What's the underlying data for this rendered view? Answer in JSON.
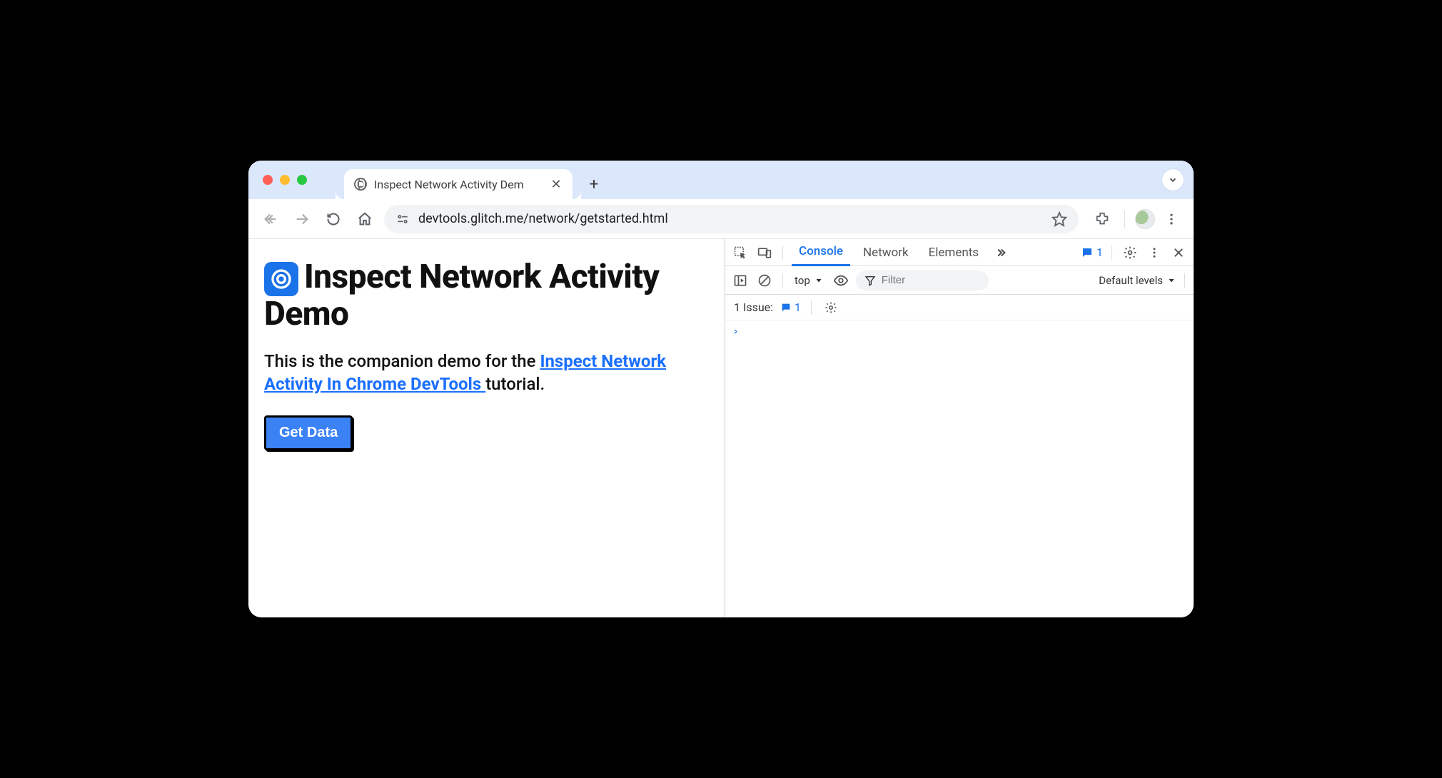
{
  "browser": {
    "tab_title": "Inspect Network Activity Dem",
    "url": "devtools.glitch.me/network/getstarted.html"
  },
  "page": {
    "title": "Inspect Network Activity Demo",
    "paragraph_prefix": "This is the companion demo for the ",
    "link_text": "Inspect Network Activity In Chrome DevTools ",
    "paragraph_suffix": "tutorial.",
    "button_label": "Get Data"
  },
  "devtools": {
    "tabs": {
      "console": "Console",
      "network": "Network",
      "elements": "Elements"
    },
    "issue_chip_count": "1",
    "context_label": "top",
    "filter_placeholder": "Filter",
    "levels_label": "Default levels",
    "issues_label": "1 Issue:",
    "issues_count": "1",
    "prompt": "›"
  }
}
